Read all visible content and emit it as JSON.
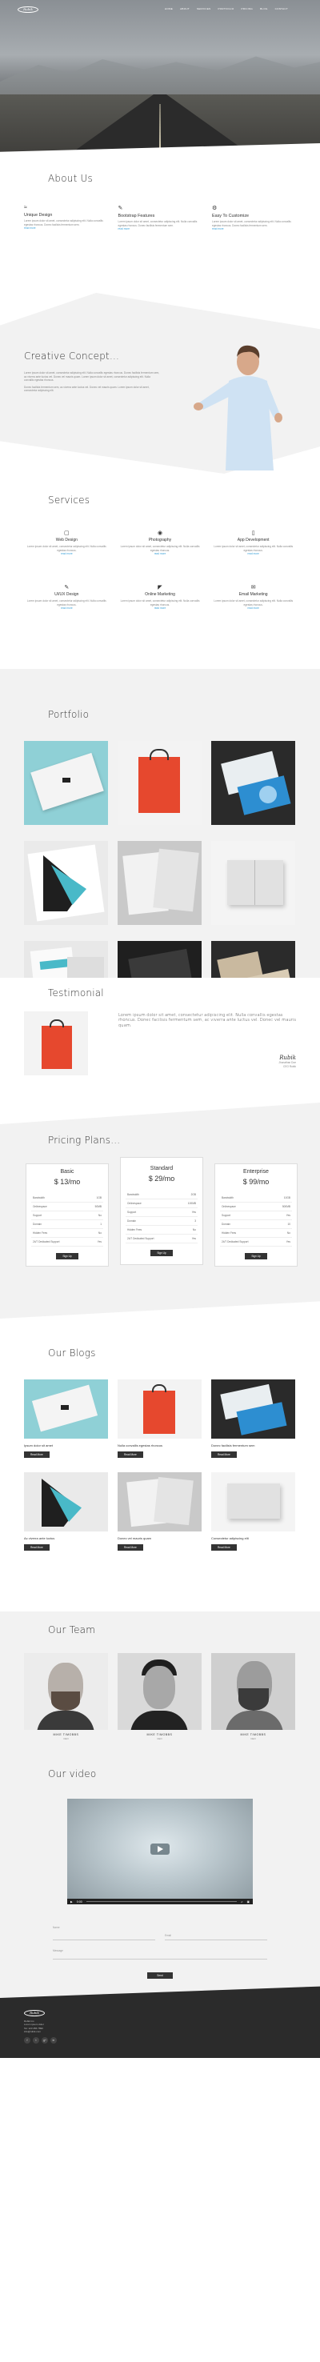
{
  "hero": {
    "logo": "Rubik",
    "nav": [
      "HOME",
      "ABOUT",
      "SERVICES",
      "PORTFOLIO",
      "PRICING",
      "BLOG",
      "CONTACT"
    ]
  },
  "about": {
    "title": "About Us",
    "features": [
      {
        "icon": "wifi-icon",
        "title": "Unique Design",
        "text": "Lorem ipsum dolor sit amet, consectetur adipiscing elit. Nulla convallis egestas rhoncus. Donec facilisis fermentum sem.",
        "link": "read more"
      },
      {
        "icon": "pencil-icon",
        "title": "Bootstrap Features",
        "text": "Lorem ipsum dolor sit amet, consectetur adipiscing elit. Nulla convallis egestas rhoncus. Donec facilisis fermentum sem.",
        "link": "read more"
      },
      {
        "icon": "gears-icon",
        "title": "Easy To Customize",
        "text": "Lorem ipsum dolor sit amet, consectetur adipiscing elit. Nulla convallis egestas rhoncus. Donec facilisis fermentum sem.",
        "link": "read more"
      }
    ]
  },
  "creative": {
    "title": "Creative Concept...",
    "p1": "Lorem ipsum dolor sit amet, consectetur adipiscing elit. Nulla convallis egestas rhoncus. Donec facilisis fermentum sem, ac viverra ante luctus vel. Donec vel mauris quam. Lorem ipsum dolor sit amet, consectetur adipiscing elit. Nulla convallis egestas rhoncus.",
    "p2": "Donec facilisis fermentum sem, ac viverra ante luctus vel. Donec vel mauris quam. Lorem ipsum dolor sit amet, consectetur adipiscing elit."
  },
  "services": {
    "title": "Services",
    "items": [
      {
        "icon": "laptop-icon",
        "title": "Web Design",
        "text": "Lorem ipsum dolor sit amet, consectetur adipiscing elit. Nulla convallis egestas rhoncus.",
        "link": "read more"
      },
      {
        "icon": "camera-icon",
        "title": "Photography",
        "text": "Lorem ipsum dolor sit amet, consectetur adipiscing elit. Nulla convallis egestas rhoncus.",
        "link": "read more"
      },
      {
        "icon": "mobile-icon",
        "title": "App Development",
        "text": "Lorem ipsum dolor sit amet, consectetur adipiscing elit. Nulla convallis egestas rhoncus.",
        "link": "read more"
      },
      {
        "icon": "pencil-icon",
        "title": "UI/UX Design",
        "text": "Lorem ipsum dolor sit amet, consectetur adipiscing elit. Nulla convallis egestas rhoncus.",
        "link": "read more"
      },
      {
        "icon": "chart-icon",
        "title": "Online Marketing",
        "text": "Lorem ipsum dolor sit amet, consectetur adipiscing elit. Nulla convallis egestas rhoncus.",
        "link": "read more"
      },
      {
        "icon": "mail-icon",
        "title": "Email Marketing",
        "text": "Lorem ipsum dolor sit amet, consectetur adipiscing elit. Nulla convallis egestas rhoncus.",
        "link": "read more"
      }
    ]
  },
  "portfolio": {
    "title": "Portfolio"
  },
  "testimonial": {
    "title": "Testimonial",
    "quote": "Lorem ipsum dolor sit amet, consectetur adipiscing elit. Nulla convallis egestas rhoncus. Donec facilisis fermentum sem, ac viverra ante luctus vel. Donec vel mauris quam.",
    "signature": "Rubik",
    "name": "Jhonathan Doe",
    "role": "CEO Rubik"
  },
  "pricing": {
    "title": "Pricing Plans...",
    "plans": [
      {
        "name": "Basic",
        "price": "$ 13/mo",
        "features": [
          [
            "Bandwidth",
            "1GB"
          ],
          [
            "Onlinespace",
            "50MB"
          ],
          [
            "Support",
            "No"
          ],
          [
            "Domain",
            "1"
          ],
          [
            "Hidden Fees",
            "No"
          ],
          [
            "24/7 Dedicated Support",
            "Yes"
          ]
        ],
        "button": "Sign Up"
      },
      {
        "name": "Standard",
        "price": "$ 29/mo",
        "features": [
          [
            "Bandwidth",
            "2GB"
          ],
          [
            "Onlinespace",
            "100MB"
          ],
          [
            "Support",
            "Yes"
          ],
          [
            "Domain",
            "3"
          ],
          [
            "Hidden Fees",
            "No"
          ],
          [
            "24/7 Dedicated Support",
            "Yes"
          ]
        ],
        "button": "Sign Up"
      },
      {
        "name": "Enterprise",
        "price": "$ 99/mo",
        "features": [
          [
            "Bandwidth",
            "10GB"
          ],
          [
            "Onlinespace",
            "500MB"
          ],
          [
            "Support",
            "Yes"
          ],
          [
            "Domain",
            "10"
          ],
          [
            "Hidden Fees",
            "No"
          ],
          [
            "24/7 Dedicated Support",
            "Yes"
          ]
        ],
        "button": "Sign Up"
      }
    ]
  },
  "blogs": {
    "title": "Our Blogs",
    "posts": [
      {
        "title": "Ipsum dolor sit amet",
        "button": "Read More"
      },
      {
        "title": "Nulla convallis egestas rhoncus",
        "button": "Read More"
      },
      {
        "title": "Donec facilisis fermentum sem",
        "button": "Read More"
      },
      {
        "title": "Ac viverra ante luctus",
        "button": "Read More"
      },
      {
        "title": "Donec vel mauris quam",
        "button": "Read More"
      },
      {
        "title": "Consectetur adipiscing elit",
        "button": "Read More"
      }
    ]
  },
  "team": {
    "title": "Our Team",
    "members": [
      {
        "name": "MIKE TIMOBBS",
        "role": "CEO"
      },
      {
        "name": "MIKE TIMOBBS",
        "role": "CEO"
      },
      {
        "name": "MIKE TIMOBBS",
        "role": "CEO"
      }
    ]
  },
  "video": {
    "title": "Our video",
    "time": "0:00"
  },
  "contact": {
    "name_placeholder": "Name",
    "email_placeholder": "Email",
    "message_placeholder": "Message",
    "button": "Send"
  },
  "footer": {
    "logo": "Rubik",
    "address": [
      "Rubik Inc.",
      "Lorem ipsum dolor",
      "Tel: 123 456 7890",
      "info@rubik.com"
    ],
    "social": [
      "f",
      "t",
      "g+",
      "in"
    ]
  }
}
